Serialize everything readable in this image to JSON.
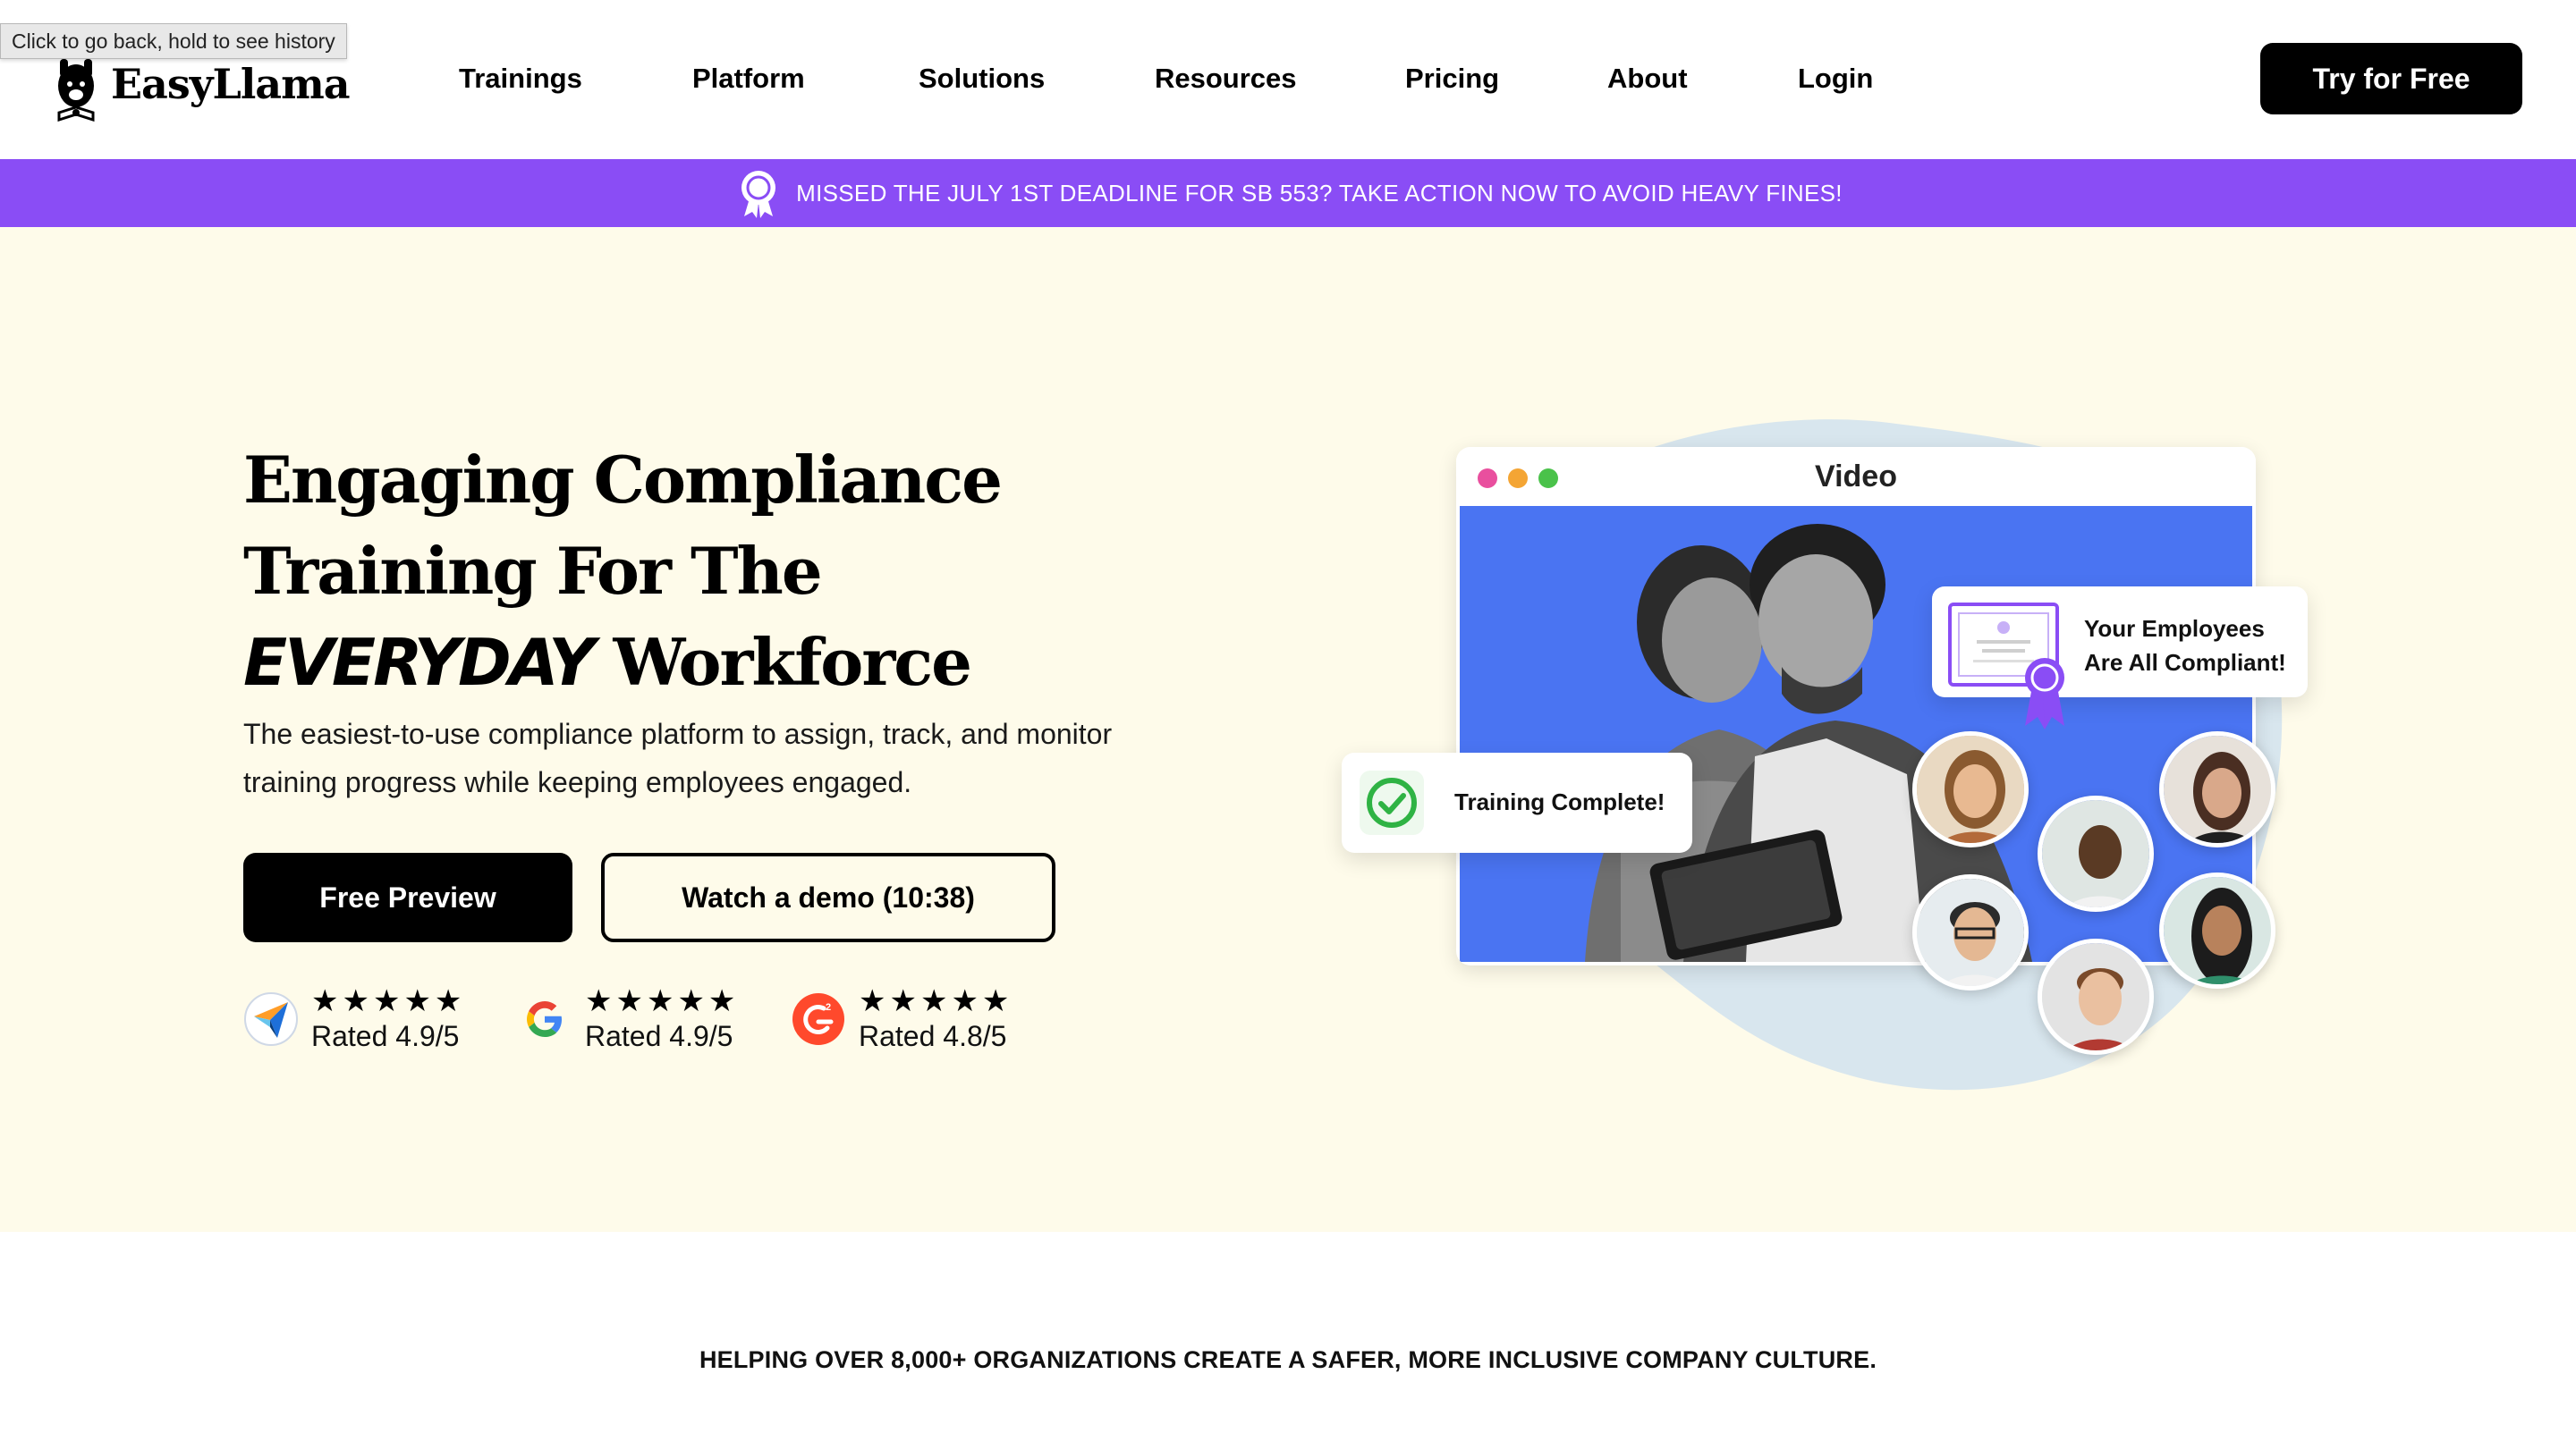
{
  "browser": {
    "tooltip": "Click to go back, hold to see history"
  },
  "header": {
    "logo_text": "EasyLlama",
    "nav": [
      {
        "label": "Trainings"
      },
      {
        "label": "Platform"
      },
      {
        "label": "Solutions"
      },
      {
        "label": "Resources"
      },
      {
        "label": "Pricing"
      },
      {
        "label": "About"
      },
      {
        "label": "Login"
      }
    ],
    "cta_label": "Try for Free"
  },
  "banner": {
    "text": "MISSED THE JULY 1ST DEADLINE FOR SB 553? TAKE ACTION NOW TO AVOID HEAVY FINES!",
    "icon": "award-ribbon-icon",
    "color": "#8a4df5"
  },
  "hero": {
    "headline_line1": "Engaging Compliance",
    "headline_line2": "Training For The",
    "headline_em": "EVERYDAY",
    "headline_line3_rest": " Workforce",
    "subtext": "The easiest-to-use compliance platform to assign, track, and monitor training progress while keeping employees engaged.",
    "primary_button": "Free Preview",
    "secondary_button": "Watch a demo (10:38)",
    "background": "#fefbea",
    "ratings": [
      {
        "source_icon": "capterra-icon",
        "stars": "★★★★★",
        "text": "Rated 4.9/5"
      },
      {
        "source_icon": "google-icon",
        "stars": "★★★★★",
        "text": "Rated 4.9/5"
      },
      {
        "source_icon": "g2-icon",
        "stars": "★★★★★",
        "text": "Rated 4.8/5"
      }
    ]
  },
  "illustration": {
    "window_title": "Video",
    "compliant_line1": "Your Employees",
    "compliant_line2": "Are All Compliant!",
    "training_complete": "Training Complete!",
    "video_bg": "#4a74f2",
    "blob_color": "#d8e6ee"
  },
  "footer_tagline": "HELPING OVER 8,000+ ORGANIZATIONS CREATE A SAFER, MORE INCLUSIVE COMPANY CULTURE."
}
